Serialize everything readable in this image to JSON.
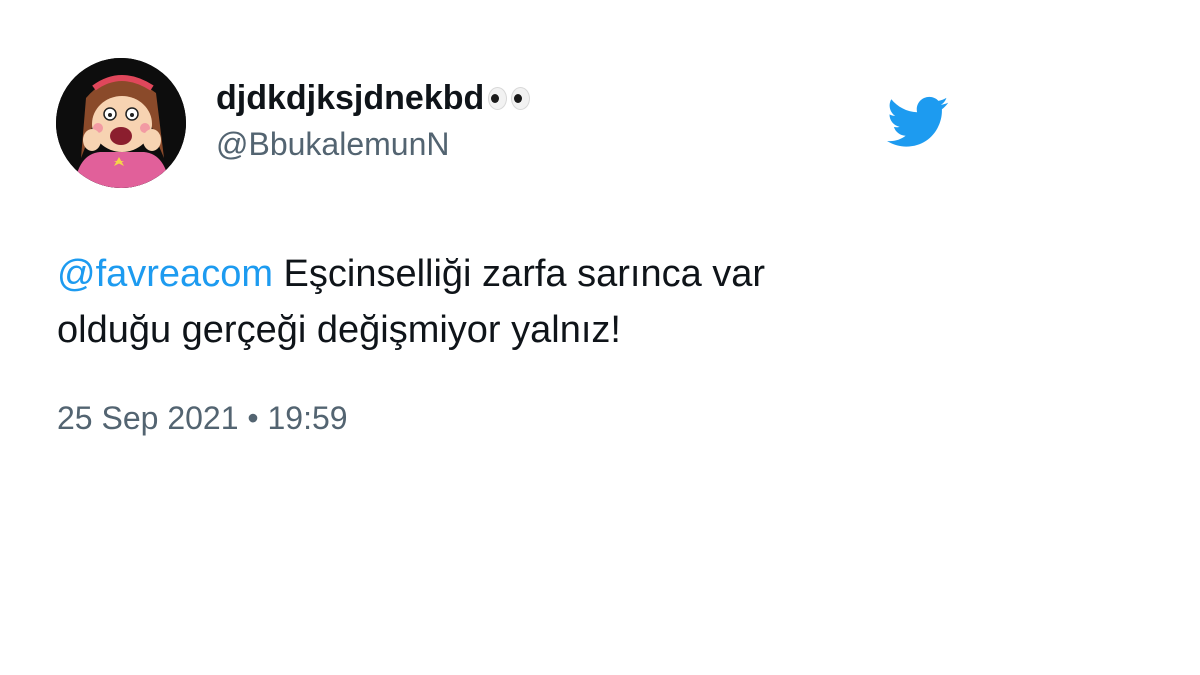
{
  "tweet": {
    "user": {
      "display_name": "djdkdjksjdnekbd",
      "name_emoji": "eyes-emoji",
      "handle": "@BbukalemunN",
      "avatar": "cartoon-girl-avatar"
    },
    "text": {
      "mention": "@favreacom",
      "line1_rest": " Eşcinselliği zarfa sarınca var",
      "line2": "olduğu gerçeği değişmiyor yalnız!"
    },
    "date": "25 Sep 2021",
    "separator": "•",
    "time": "19:59"
  },
  "colors": {
    "accent": "#1d9bf0",
    "text_primary": "#0f1419",
    "text_secondary": "#536471",
    "background": "#ffffff"
  },
  "icons": {
    "brand": "twitter-bird-icon"
  }
}
